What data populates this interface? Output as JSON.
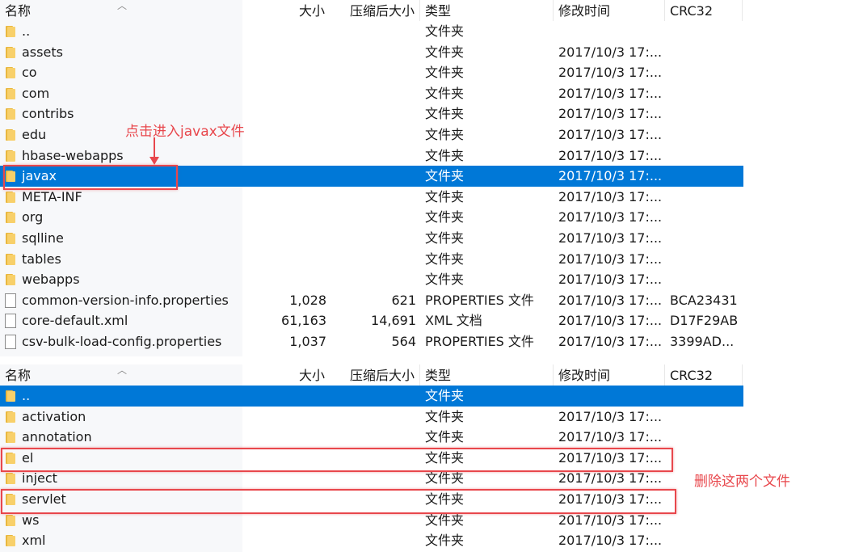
{
  "columns": {
    "name": "名称",
    "size": "大小",
    "compressed": "压缩后大小",
    "type": "类型",
    "modified": "修改时间",
    "crc": "CRC32"
  },
  "top_pane": {
    "rows": [
      {
        "icon": "folder-icon",
        "name": "..",
        "size": "",
        "compressed": "",
        "type": "文件夹",
        "modified": "",
        "crc": "",
        "selected": false
      },
      {
        "icon": "folder-icon",
        "name": "assets",
        "size": "",
        "compressed": "",
        "type": "文件夹",
        "modified": "2017/10/3 17:...",
        "crc": "",
        "selected": false
      },
      {
        "icon": "folder-icon",
        "name": "co",
        "size": "",
        "compressed": "",
        "type": "文件夹",
        "modified": "2017/10/3 17:...",
        "crc": "",
        "selected": false
      },
      {
        "icon": "folder-icon",
        "name": "com",
        "size": "",
        "compressed": "",
        "type": "文件夹",
        "modified": "2017/10/3 17:...",
        "crc": "",
        "selected": false
      },
      {
        "icon": "folder-icon",
        "name": "contribs",
        "size": "",
        "compressed": "",
        "type": "文件夹",
        "modified": "2017/10/3 17:...",
        "crc": "",
        "selected": false
      },
      {
        "icon": "folder-icon",
        "name": "edu",
        "size": "",
        "compressed": "",
        "type": "文件夹",
        "modified": "2017/10/3 17:...",
        "crc": "",
        "selected": false
      },
      {
        "icon": "folder-icon",
        "name": "hbase-webapps",
        "size": "",
        "compressed": "",
        "type": "文件夹",
        "modified": "2017/10/3 17:...",
        "crc": "",
        "selected": false
      },
      {
        "icon": "folder-icon",
        "name": "javax",
        "size": "",
        "compressed": "",
        "type": "文件夹",
        "modified": "2017/10/3 17:...",
        "crc": "",
        "selected": true
      },
      {
        "icon": "folder-icon",
        "name": "META-INF",
        "size": "",
        "compressed": "",
        "type": "文件夹",
        "modified": "2017/10/3 17:...",
        "crc": "",
        "selected": false
      },
      {
        "icon": "folder-icon",
        "name": "org",
        "size": "",
        "compressed": "",
        "type": "文件夹",
        "modified": "2017/10/3 17:...",
        "crc": "",
        "selected": false
      },
      {
        "icon": "folder-icon",
        "name": "sqlline",
        "size": "",
        "compressed": "",
        "type": "文件夹",
        "modified": "2017/10/3 17:...",
        "crc": "",
        "selected": false
      },
      {
        "icon": "folder-icon",
        "name": "tables",
        "size": "",
        "compressed": "",
        "type": "文件夹",
        "modified": "2017/10/3 17:...",
        "crc": "",
        "selected": false
      },
      {
        "icon": "folder-icon",
        "name": "webapps",
        "size": "",
        "compressed": "",
        "type": "文件夹",
        "modified": "2017/10/3 17:...",
        "crc": "",
        "selected": false
      },
      {
        "icon": "file-icon",
        "name": "common-version-info.properties",
        "size": "1,028",
        "compressed": "621",
        "type": "PROPERTIES 文件",
        "modified": "2017/10/3 17:...",
        "crc": "BCA23431",
        "selected": false
      },
      {
        "icon": "file-icon",
        "name": "core-default.xml",
        "size": "61,163",
        "compressed": "14,691",
        "type": "XML 文档",
        "modified": "2017/10/3 17:...",
        "crc": "D17F29AB",
        "selected": false
      },
      {
        "icon": "file-icon",
        "name": "csv-bulk-load-config.properties",
        "size": "1,037",
        "compressed": "564",
        "type": "PROPERTIES 文件",
        "modified": "2017/10/3 17:...",
        "crc": "3399AD...",
        "selected": false
      }
    ]
  },
  "bottom_pane": {
    "rows": [
      {
        "icon": "folder-icon",
        "name": "..",
        "size": "",
        "compressed": "",
        "type": "文件夹",
        "modified": "",
        "crc": "",
        "selected": true
      },
      {
        "icon": "folder-icon",
        "name": "activation",
        "size": "",
        "compressed": "",
        "type": "文件夹",
        "modified": "2017/10/3 17:...",
        "crc": "",
        "selected": false
      },
      {
        "icon": "folder-icon",
        "name": "annotation",
        "size": "",
        "compressed": "",
        "type": "文件夹",
        "modified": "2017/10/3 17:...",
        "crc": "",
        "selected": false
      },
      {
        "icon": "folder-icon",
        "name": "el",
        "size": "",
        "compressed": "",
        "type": "文件夹",
        "modified": "2017/10/3 17:...",
        "crc": "",
        "selected": false
      },
      {
        "icon": "folder-icon",
        "name": "inject",
        "size": "",
        "compressed": "",
        "type": "文件夹",
        "modified": "2017/10/3 17:...",
        "crc": "",
        "selected": false
      },
      {
        "icon": "folder-icon",
        "name": "servlet",
        "size": "",
        "compressed": "",
        "type": "文件夹",
        "modified": "2017/10/3 17:...",
        "crc": "",
        "selected": false
      },
      {
        "icon": "folder-icon",
        "name": "ws",
        "size": "",
        "compressed": "",
        "type": "文件夹",
        "modified": "2017/10/3 17:...",
        "crc": "",
        "selected": false
      },
      {
        "icon": "folder-icon",
        "name": "xml",
        "size": "",
        "compressed": "",
        "type": "文件夹",
        "modified": "2017/10/3 17:...",
        "crc": "",
        "selected": false
      }
    ]
  },
  "annotations": {
    "enter_javax": "点击进入javax文件",
    "delete_two": "删除这两个文件"
  },
  "colors": {
    "selection": "#0078d7",
    "annotation": "#e8474c",
    "folder": "#f8d06a"
  }
}
